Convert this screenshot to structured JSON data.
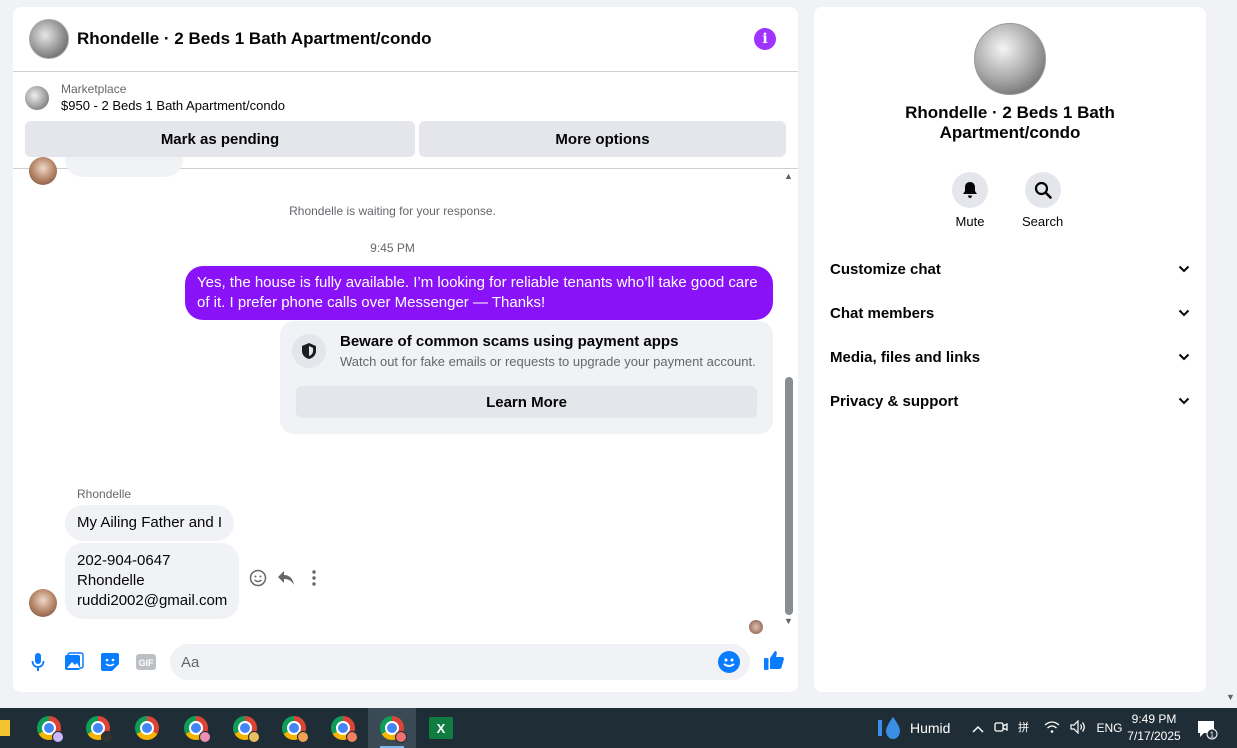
{
  "chat": {
    "title": "Rhondelle · 2 Beds 1 Bath Apartment/condo",
    "marketplace_label": "Marketplace",
    "listing": "$950 - 2 Beds 1 Bath Apartment/condo",
    "mark_pending": "Mark as pending",
    "more_options": "More options",
    "waiting_text": "Rhondelle is waiting for your response.",
    "timestamp": "9:45 PM",
    "outgoing_message": "Yes, the house is fully available. I’m looking for reliable tenants who’ll take good care of it. I prefer phone calls over Messenger —  Thanks!",
    "warning_title": "Beware of common scams using payment apps",
    "warning_sub": "Watch out for fake emails or requests to upgrade your payment account.",
    "learn_more": "Learn More",
    "sender_name": "Rhondelle",
    "incoming_1": "My Ailing Father and I",
    "incoming_2_line1": "202-904-0647",
    "incoming_2_line2": "Rhondelle",
    "incoming_2_line3": "ruddi2002@gmail.com",
    "input_placeholder": "Aa"
  },
  "info": {
    "title": "Rhondelle · 2 Beds 1 Bath Apartment/condo",
    "mute": "Mute",
    "search": "Search",
    "sections": [
      "Customize chat",
      "Chat members",
      "Media, files and links",
      "Privacy & support"
    ]
  },
  "taskbar": {
    "weather": "Humid",
    "language": "ENG",
    "time": "9:49 PM",
    "date": "7/17/2025",
    "notification_count": "1"
  },
  "colors": {
    "accent": "#a033ff",
    "outgoing_bubble": "#8a12f9",
    "messenger_blue": "#0a7cff"
  }
}
